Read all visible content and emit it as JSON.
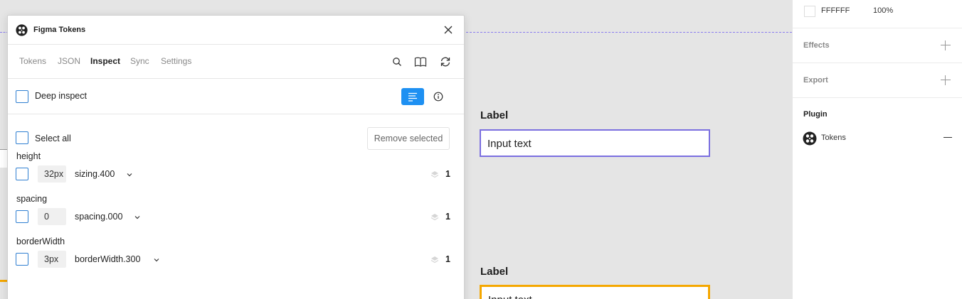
{
  "plugin": {
    "title": "Figma Tokens",
    "tabs": [
      "Tokens",
      "JSON",
      "Inspect",
      "Sync",
      "Settings"
    ],
    "active_tab": "Inspect",
    "deep_inspect_label": "Deep inspect",
    "select_all_label": "Select all",
    "remove_selected_label": "Remove selected",
    "groups": [
      {
        "title": "height",
        "value": "32px",
        "token": "sizing.400",
        "count": "1"
      },
      {
        "title": "spacing",
        "value": "0",
        "token": "spacing.000",
        "count": "1"
      },
      {
        "title": "borderWidth",
        "value": "3px",
        "token": "borderWidth.300",
        "count": "1"
      }
    ]
  },
  "canvas": {
    "label_1": "Label",
    "input_1": "Input text",
    "label_2": "Label",
    "input_2": "Input text"
  },
  "sidebar": {
    "fill_hex": "FFFFFF",
    "fill_opacity": "100%",
    "effects_label": "Effects",
    "export_label": "Export",
    "plugin_label": "Plugin",
    "plugin_name": "Tokens"
  },
  "colors": {
    "accent_blue": "#1e90f2",
    "guide_purple": "#8a7df0",
    "input_purple": "#7b6fe0",
    "input_orange": "#f5a700"
  },
  "icons": [
    "figma-tokens-logo-icon",
    "close-icon",
    "search-icon",
    "book-icon",
    "sync-icon",
    "list-icon",
    "info-icon",
    "chevron-down-icon",
    "layers-icon",
    "plus-icon",
    "minus-icon"
  ]
}
